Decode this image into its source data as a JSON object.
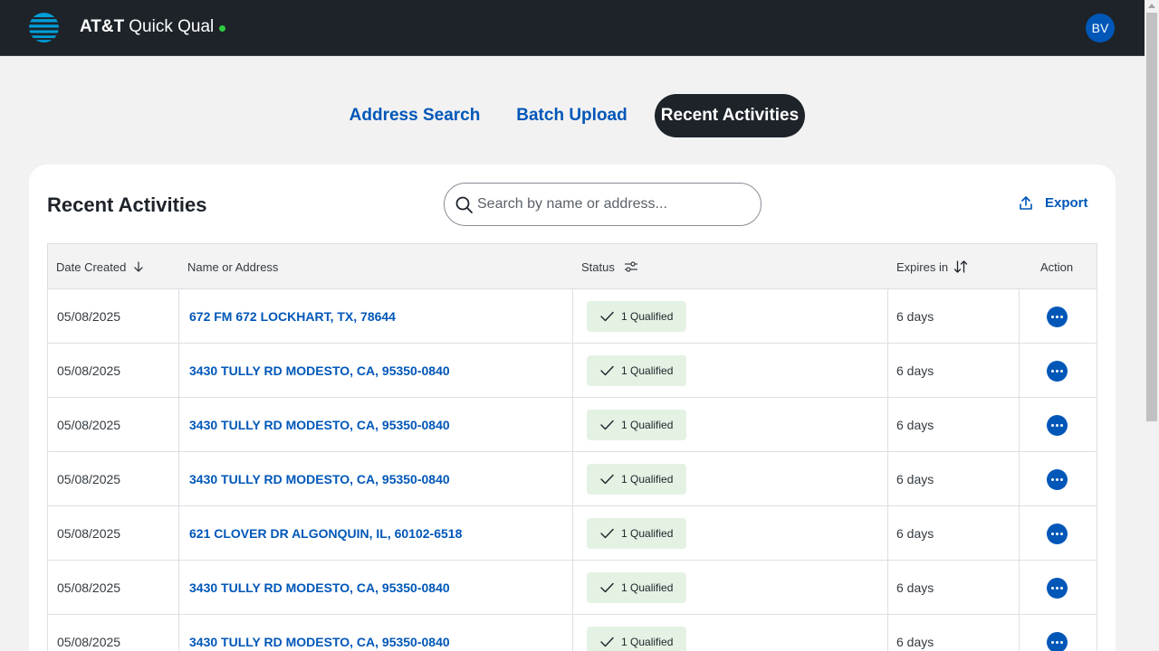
{
  "header": {
    "logo_icon": "att-globe-icon",
    "brand_bold": "AT&T",
    "brand_rest": "Quick Qual",
    "status_dot_color": "#2ecc40",
    "avatar_initials": "BV"
  },
  "tabs": [
    {
      "label": "Address Search",
      "active": false
    },
    {
      "label": "Batch Upload",
      "active": false
    },
    {
      "label": "Recent Activities",
      "active": true
    }
  ],
  "panel": {
    "title": "Recent Activities",
    "search_placeholder": "Search by name or address...",
    "search_icon": "search-icon",
    "export_label": "Export",
    "export_icon": "upload-icon"
  },
  "table": {
    "columns": [
      {
        "label": "Date Created",
        "icon": "arrow-down-icon"
      },
      {
        "label": "Name or Address"
      },
      {
        "label": "Status",
        "icon": "filter-sliders-icon"
      },
      {
        "label": "Expires in",
        "icon": "sort-arrows-icon"
      },
      {
        "label": "Action"
      }
    ],
    "rows": [
      {
        "date": "05/08/2025",
        "address": "672 FM 672 LOCKHART, TX, 78644",
        "status": "1 Qualified",
        "expires": "6 days"
      },
      {
        "date": "05/08/2025",
        "address": "3430 TULLY RD MODESTO, CA, 95350-0840",
        "status": "1 Qualified",
        "expires": "6 days"
      },
      {
        "date": "05/08/2025",
        "address": "3430 TULLY RD MODESTO, CA, 95350-0840",
        "status": "1 Qualified",
        "expires": "6 days"
      },
      {
        "date": "05/08/2025",
        "address": "3430 TULLY RD MODESTO, CA, 95350-0840",
        "status": "1 Qualified",
        "expires": "6 days"
      },
      {
        "date": "05/08/2025",
        "address": "621 CLOVER DR ALGONQUIN, IL, 60102-6518",
        "status": "1 Qualified",
        "expires": "6 days"
      },
      {
        "date": "05/08/2025",
        "address": "3430 TULLY RD MODESTO, CA, 95350-0840",
        "status": "1 Qualified",
        "expires": "6 days"
      },
      {
        "date": "05/08/2025",
        "address": "3430 TULLY RD MODESTO, CA, 95350-0840",
        "status": "1 Qualified",
        "expires": "6 days"
      }
    ]
  },
  "colors": {
    "brand_blue": "#0057b8",
    "dark": "#1d2329",
    "qualified_bg": "#e4f2e4"
  }
}
